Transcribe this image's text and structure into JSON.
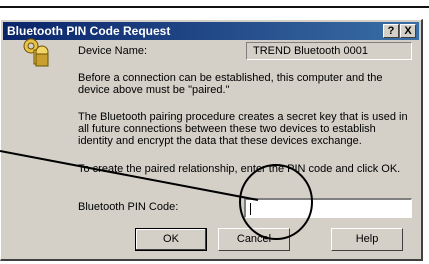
{
  "dialog": {
    "title": "Bluetooth PIN Code Request",
    "title_help_button": "?",
    "title_close_button": "X",
    "device_name_label": "Device Name:",
    "device_name_value": "TREND Bluetooth 0001",
    "para1": "Before a connection can be established, this computer and the device above must be \"paired.\"",
    "para2": "The Bluetooth pairing procedure creates a secret key that is used in all future connections between these two devices to establish identity and encrypt the data that these devices exchange.",
    "para3": "To create the paired relationship, enter the PIN code and click OK.",
    "pin_label": "Bluetooth PIN Code:",
    "pin_value": ""
  },
  "buttons": {
    "ok": "OK",
    "cancel": "Cancel",
    "help": "Help"
  },
  "icons": {
    "dialog_icon": "key-lock-icon"
  }
}
